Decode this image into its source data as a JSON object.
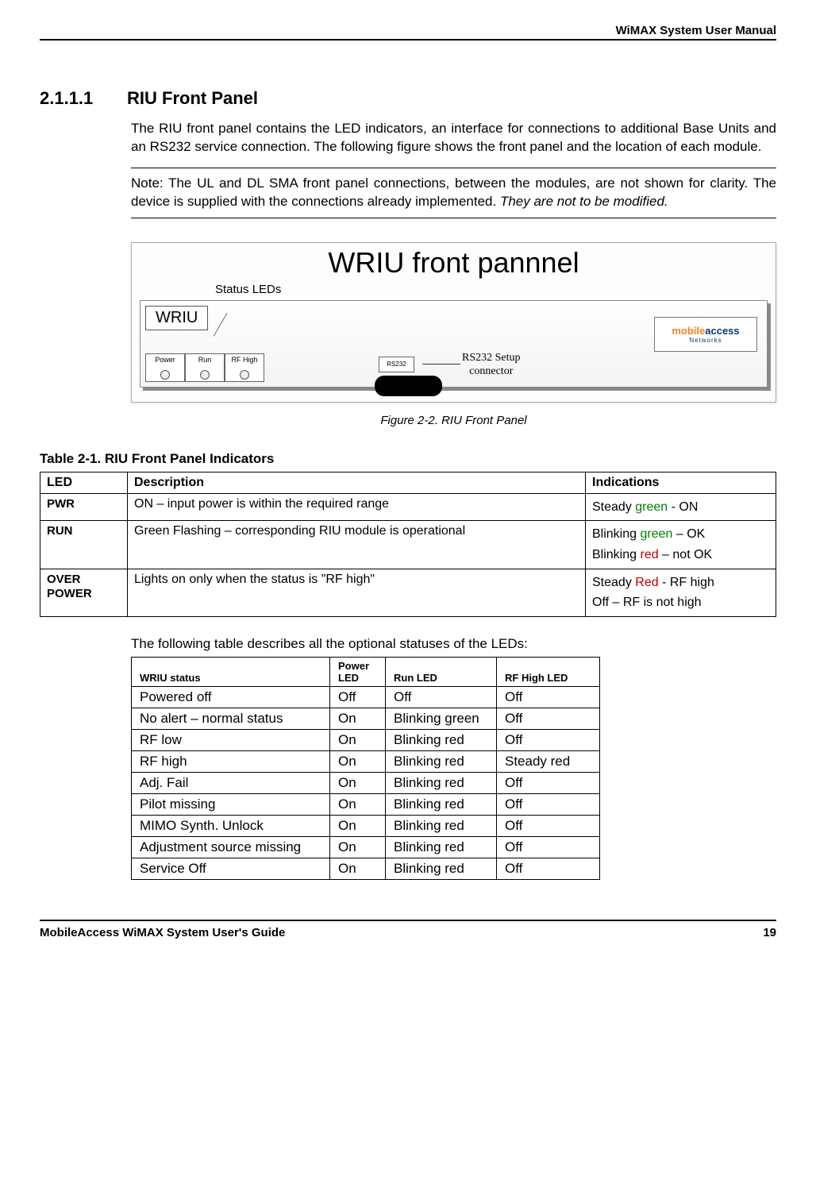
{
  "header_right": "WiMAX System User Manual",
  "section": {
    "num": "2.1.1.1",
    "title": "RIU Front Panel"
  },
  "para1": "The RIU front panel contains the LED indicators, an interface for connections to additional Base Units and an RS232 service connection. The following figure shows the front panel and the location of each module.",
  "note": {
    "text": "Note: The UL and DL SMA front panel connections, between the modules, are not shown for clarity. The device is supplied with the connections already implemented. ",
    "italic": "They are not to be modified."
  },
  "figure": {
    "title": "WRIU front pannnel",
    "status_label": "Status LEDs",
    "badge": "WRIU",
    "leds": [
      "Power",
      "Run",
      "RF High"
    ],
    "rs232_box": "RS232",
    "rs232_label_l1": "RS232 Setup",
    "rs232_label_l2": "connector",
    "logo_p1": "mobile",
    "logo_p2": "access",
    "logo_sub": "Networks",
    "caption": "Figure 2-2.  RIU Front Panel"
  },
  "table1": {
    "title": "Table 2-1.  RIU Front Panel Indicators",
    "headers": [
      "LED",
      "Description",
      "Indications"
    ],
    "rows": [
      {
        "led": "PWR",
        "desc": "ON –  input power is within the required range",
        "ind": [
          {
            "pre": "Steady ",
            "color": "green",
            "word": "green",
            "post": " - ON"
          }
        ]
      },
      {
        "led": "RUN",
        "desc": "Green Flashing – corresponding RIU module is operational",
        "ind": [
          {
            "pre": "Blinking ",
            "color": "green",
            "word": "green",
            "post": " – OK"
          },
          {
            "pre": "Blinking ",
            "color": "red",
            "word": "red",
            "post": " – not OK"
          }
        ]
      },
      {
        "led": "OVER POWER",
        "desc": "Lights on only when the status is \"RF high\"",
        "ind": [
          {
            "pre": "Steady ",
            "color": "red",
            "word": "Red",
            "post": "  - RF high"
          },
          {
            "pre": "",
            "color": "",
            "word": "",
            "post": "Off – RF is not high"
          }
        ]
      }
    ]
  },
  "subdesc": "The following table describes all the optional statuses of the LEDs:",
  "table2": {
    "headers": [
      "WRIU status",
      "Power LED",
      "Run LED",
      "RF High LED"
    ],
    "rows": [
      [
        "Powered off",
        "Off",
        "Off",
        "Off"
      ],
      [
        "No alert – normal status",
        "On",
        "Blinking green",
        "Off"
      ],
      [
        "RF low",
        "On",
        "Blinking red",
        "Off"
      ],
      [
        "RF high",
        "On",
        "Blinking red",
        "Steady red"
      ],
      [
        "Adj. Fail",
        "On",
        "Blinking red",
        "Off"
      ],
      [
        "Pilot missing",
        "On",
        "Blinking red",
        "Off"
      ],
      [
        "MIMO Synth. Unlock",
        "On",
        "Blinking red",
        "Off"
      ],
      [
        "Adjustment source missing",
        "On",
        "Blinking red",
        "Off"
      ],
      [
        "Service Off",
        "On",
        "Blinking red",
        "Off"
      ]
    ]
  },
  "footer": {
    "left": "MobileAccess WiMAX System User's Guide",
    "right": "19"
  }
}
